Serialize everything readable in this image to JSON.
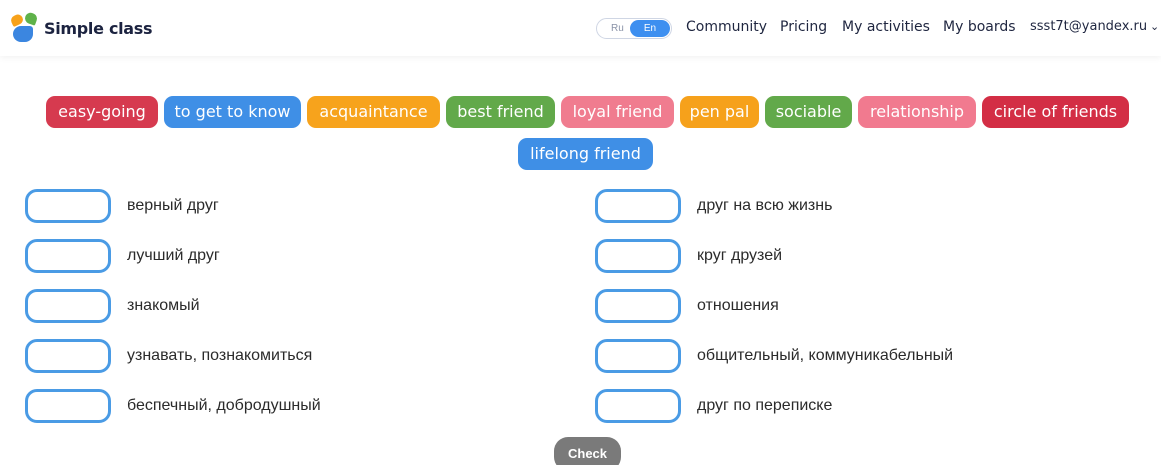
{
  "header": {
    "app_name": "Simple class",
    "lang": {
      "ru": "Ru",
      "en": "En",
      "selected": "En"
    },
    "nav": {
      "community": "Community",
      "pricing": "Pricing",
      "activities": "My activities",
      "boards": "My boards",
      "user": "ssst7t@yandex.ru"
    }
  },
  "chips": [
    {
      "label": "easy-going",
      "color": "#d63a4f"
    },
    {
      "label": "to get to know",
      "color": "#3f8fe6"
    },
    {
      "label": "acquaintance",
      "color": "#f7a31c"
    },
    {
      "label": "best friend",
      "color": "#62a94a"
    },
    {
      "label": "loyal friend",
      "color": "#f07c8f"
    },
    {
      "label": "pen pal",
      "color": "#f6a11b"
    },
    {
      "label": "sociable",
      "color": "#62a94a"
    },
    {
      "label": "relationship",
      "color": "#f17a8f"
    },
    {
      "label": "circle of friends",
      "color": "#d32e45"
    },
    {
      "label": "lifelong friend",
      "color": "#3f8fe6"
    }
  ],
  "left_items": [
    "верный друг",
    "лучший друг",
    "знакомый",
    "узнавать, познакомиться",
    "беспечный, добродушный"
  ],
  "right_items": [
    "друг на всю жизнь",
    "круг друзей",
    "отношения",
    "общительный, коммуникабельный",
    "друг по переписке"
  ],
  "check_label": "Check"
}
